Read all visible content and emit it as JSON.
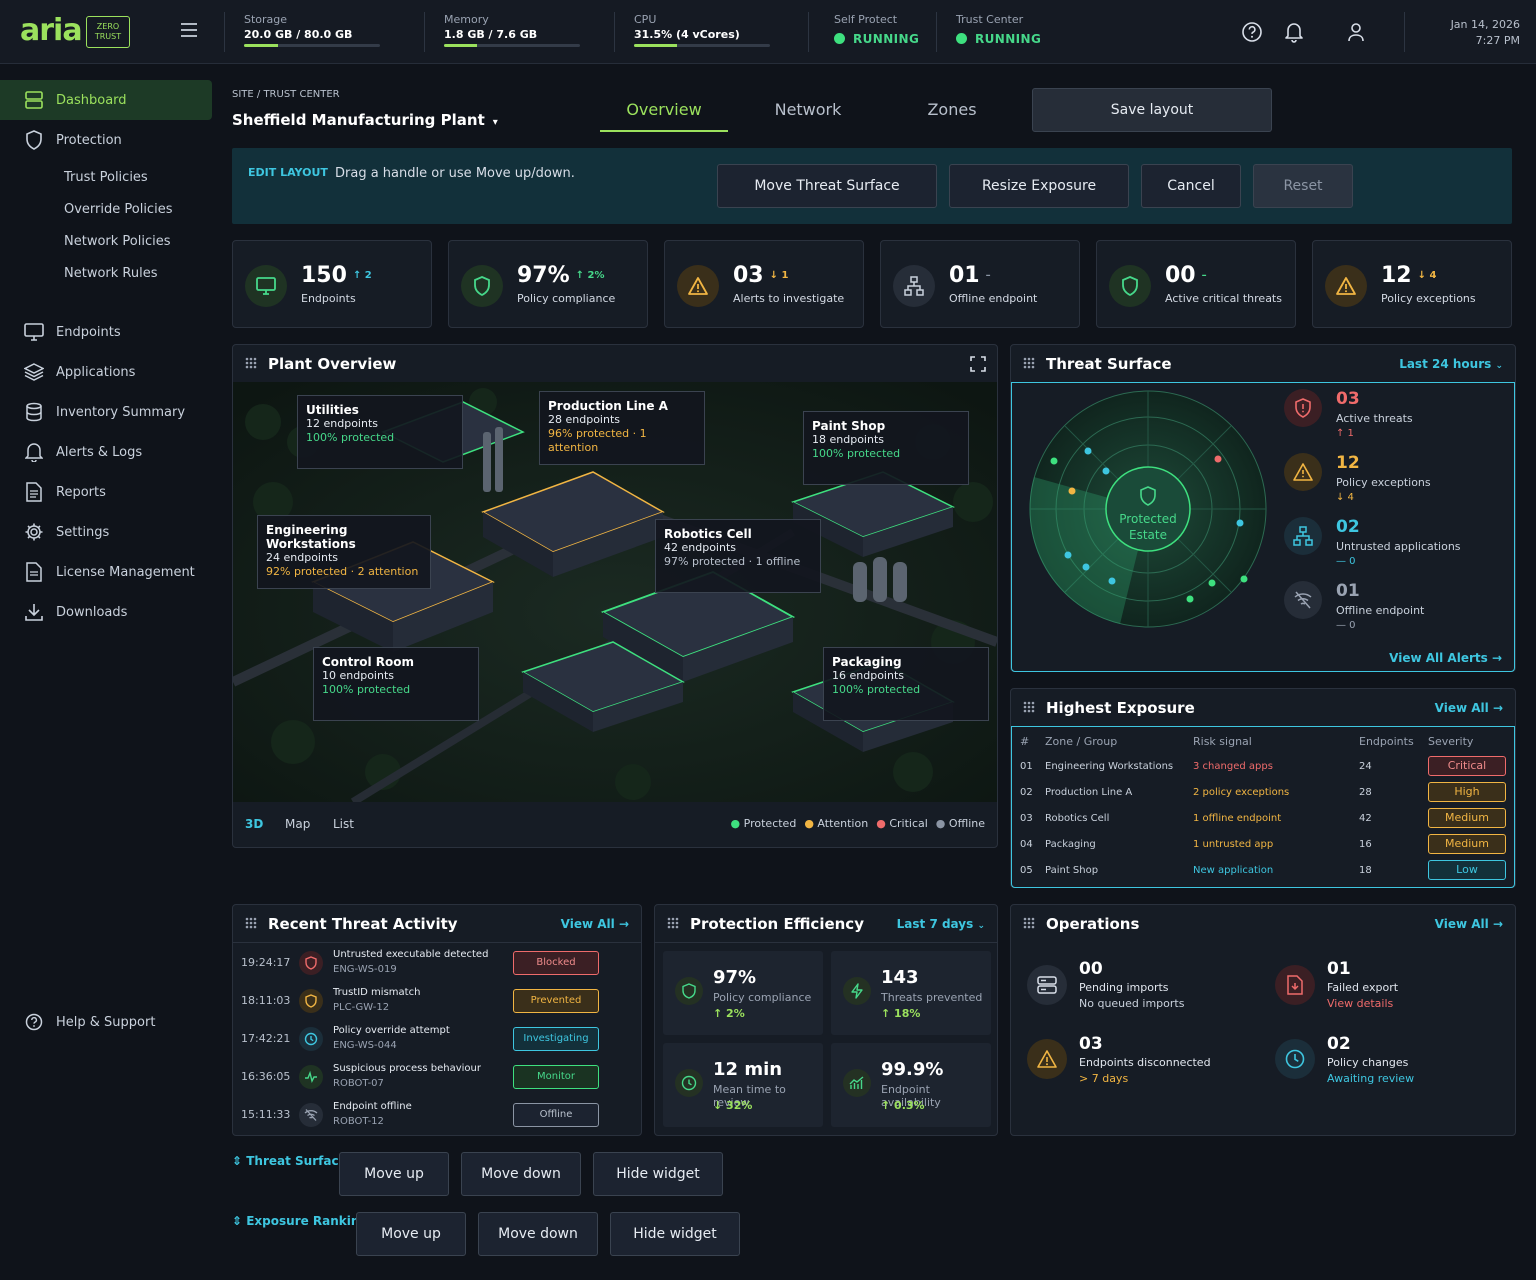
{
  "brand": {
    "logo": "aria",
    "badge_line1": "ZERO",
    "badge_line2": "TRUST"
  },
  "metrics": [
    {
      "label": "Storage",
      "value": "20.0 GB / 80.0 GB",
      "fraction": 0.25
    },
    {
      "label": "Memory",
      "value": "1.8 GB / 7.6 GB",
      "fraction": 0.24
    },
    {
      "label": "CPU",
      "value": "31.5% (4 vCores)",
      "fraction": 0.315
    }
  ],
  "status": [
    {
      "label": "Self Protect",
      "value": "RUNNING"
    },
    {
      "label": "Trust Center",
      "value": "RUNNING"
    }
  ],
  "datetime": {
    "date": "Jan 14, 2026",
    "time": "7:27 PM"
  },
  "sidebar": {
    "items": [
      {
        "label": "Dashboard",
        "icon": "dashboard-icon"
      },
      {
        "label": "Protection",
        "icon": "shield-icon"
      },
      {
        "label": "Endpoints",
        "icon": "monitor-icon"
      },
      {
        "label": "Applications",
        "icon": "layers-icon"
      },
      {
        "label": "Inventory Summary",
        "icon": "database-icon"
      },
      {
        "label": "Alerts & Logs",
        "icon": "bell-icon"
      },
      {
        "label": "Reports",
        "icon": "report-icon"
      },
      {
        "label": "Settings",
        "icon": "gear-icon"
      },
      {
        "label": "License Management",
        "icon": "license-icon"
      },
      {
        "label": "Downloads",
        "icon": "download-icon"
      }
    ],
    "subitems": [
      "Trust Policies",
      "Override Policies",
      "Network Policies",
      "Network Rules"
    ],
    "help": "Help & Support"
  },
  "header": {
    "breadcrumb": "SITE / TRUST CENTER",
    "site": "Sheffield Manufacturing Plant",
    "tabs": [
      "Overview",
      "Network",
      "Zones"
    ],
    "save": "Save layout"
  },
  "edit_bar": {
    "tag": "EDIT LAYOUT",
    "hint": "Drag a handle or use Move up/down.",
    "buttons": [
      "Move Threat Surface",
      "Resize Exposure",
      "Cancel",
      "Reset"
    ]
  },
  "kpis": [
    {
      "value": "150",
      "delta": "↑ 2",
      "label": "Endpoints",
      "icon": "monitor-icon"
    },
    {
      "value": "97%",
      "delta": "↑ 2%",
      "label": "Policy compliance",
      "icon": "shield-icon"
    },
    {
      "value": "03",
      "delta": "↓ 1",
      "label": "Alerts to investigate",
      "icon": "warning-icon"
    },
    {
      "value": "01",
      "delta": "–",
      "label": "Offline endpoint",
      "icon": "network-icon"
    },
    {
      "value": "00",
      "delta": "–",
      "label": "Active critical threats",
      "icon": "shield-icon"
    },
    {
      "value": "12",
      "delta": "↓ 4",
      "label": "Policy exceptions",
      "icon": "warning-icon"
    }
  ],
  "plant": {
    "title": "Plant Overview",
    "zones": [
      {
        "name": "Utilities",
        "endpoints": "12 endpoints",
        "status": "100% protected"
      },
      {
        "name": "Production Line A",
        "endpoints": "28 endpoints",
        "status": "96% protected · 1 attention"
      },
      {
        "name": "Paint Shop",
        "endpoints": "18 endpoints",
        "status": "100% protected"
      },
      {
        "name": "Engineering Workstations",
        "endpoints": "24 endpoints",
        "status": "92% protected · 2 attention"
      },
      {
        "name": "Robotics Cell",
        "endpoints": "42 endpoints",
        "status": "97% protected · 1 offline"
      },
      {
        "name": "Control Room",
        "endpoints": "10 endpoints",
        "status": "100% protected"
      },
      {
        "name": "Packaging",
        "endpoints": "16 endpoints",
        "status": "100% protected"
      }
    ],
    "views": [
      "3D",
      "Map",
      "List"
    ],
    "legend": [
      "Protected",
      "Attention",
      "Critical",
      "Offline"
    ]
  },
  "threat_surface": {
    "title": "Threat Surface",
    "range": "Last 24 hours",
    "center_line1": "Protected",
    "center_line2": "Estate",
    "stats": [
      {
        "value": "03",
        "label": "Active threats",
        "delta": "↑ 1",
        "icon": "shield-alert-icon"
      },
      {
        "value": "12",
        "label": "Policy exceptions",
        "delta": "↓ 4",
        "icon": "warning-icon"
      },
      {
        "value": "02",
        "label": "Untrusted applications",
        "delta": "— 0",
        "icon": "network-icon"
      },
      {
        "value": "01",
        "label": "Offline endpoint",
        "delta": "— 0",
        "icon": "wifi-off-icon"
      }
    ],
    "link": "View All Alerts →"
  },
  "exposure": {
    "title": "Highest Exposure",
    "link": "View All →",
    "headers": [
      "#",
      "Zone / Group",
      "Risk signal",
      "Endpoints",
      "Severity"
    ],
    "rows": [
      {
        "n": "01",
        "zone": "Engineering Workstations",
        "signal": "3 changed apps",
        "endpoints": "24",
        "severity": "Critical"
      },
      {
        "n": "02",
        "zone": "Production Line A",
        "signal": "2 policy exceptions",
        "endpoints": "28",
        "severity": "High"
      },
      {
        "n": "03",
        "zone": "Robotics Cell",
        "signal": "1 offline endpoint",
        "endpoints": "42",
        "severity": "Medium"
      },
      {
        "n": "04",
        "zone": "Packaging",
        "signal": "1 untrusted app",
        "endpoints": "16",
        "severity": "Medium"
      },
      {
        "n": "05",
        "zone": "Paint Shop",
        "signal": "New application",
        "endpoints": "18",
        "severity": "Low"
      }
    ]
  },
  "activity": {
    "title": "Recent Threat Activity",
    "link": "View All →",
    "rows": [
      {
        "time": "19:24:17",
        "title": "Untrusted executable detected",
        "host": "ENG-WS-019",
        "status": "Blocked",
        "icon": "shield-icon"
      },
      {
        "time": "18:11:03",
        "title": "TrustID mismatch",
        "host": "PLC-GW-12",
        "status": "Prevented",
        "icon": "shield-icon"
      },
      {
        "time": "17:42:21",
        "title": "Policy override attempt",
        "host": "ENG-WS-044",
        "status": "Investigating",
        "icon": "clock-icon"
      },
      {
        "time": "16:36:05",
        "title": "Suspicious process behaviour",
        "host": "ROBOT-07",
        "status": "Monitor",
        "icon": "pulse-icon"
      },
      {
        "time": "15:11:33",
        "title": "Endpoint offline",
        "host": "ROBOT-12",
        "status": "Offline",
        "icon": "wifi-off-icon"
      }
    ]
  },
  "efficiency": {
    "title": "Protection Efficiency",
    "range": "Last 7 days",
    "cards": [
      {
        "value": "97%",
        "label": "Policy compliance",
        "delta": "↑ 2%",
        "icon": "shield-icon"
      },
      {
        "value": "143",
        "label": "Threats prevented",
        "delta": "↑ 18%",
        "icon": "bolt-icon"
      },
      {
        "value": "12 min",
        "label": "Mean time to review",
        "delta": "↓ 32%",
        "icon": "clock-icon"
      },
      {
        "value": "99.9%",
        "label": "Endpoint availability",
        "delta": "↑ 0.3%",
        "icon": "chart-icon"
      }
    ]
  },
  "operations": {
    "title": "Operations",
    "link": "View All →",
    "items": [
      {
        "value": "00",
        "label": "Pending imports",
        "sub": "No queued imports",
        "icon": "server-icon"
      },
      {
        "value": "01",
        "label": "Failed export",
        "sub": "View details",
        "icon": "file-error-icon"
      },
      {
        "value": "03",
        "label": "Endpoints disconnected",
        "sub": "> 7 days",
        "icon": "warning-icon"
      },
      {
        "value": "02",
        "label": "Policy changes",
        "sub": "Awaiting review",
        "icon": "clock-icon"
      }
    ]
  },
  "layout_controls": [
    {
      "label": "⇕ Threat Surface",
      "buttons": [
        "Move up",
        "Move down",
        "Hide widget"
      ]
    },
    {
      "label": "⇕ Exposure Ranking",
      "buttons": [
        "Move up",
        "Move down",
        "Hide widget"
      ]
    }
  ]
}
